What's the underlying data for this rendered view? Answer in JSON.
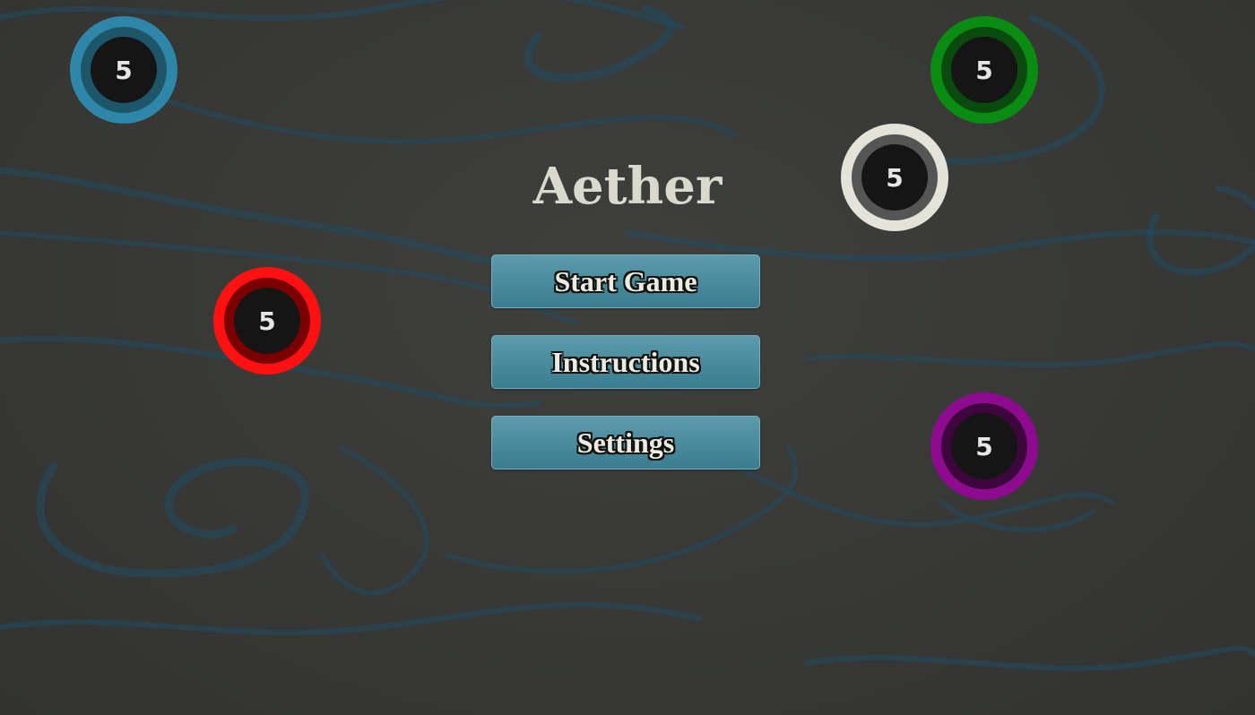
{
  "title": "Aether",
  "menu": {
    "start_label": "Start Game",
    "instructions_label": "Instructions",
    "settings_label": "Settings"
  },
  "tokens": [
    {
      "id": "blue",
      "value": "5",
      "ring": "#2e86a8",
      "inner": "#1d5569"
    },
    {
      "id": "green",
      "value": "5",
      "ring": "#0a8c12",
      "inner": "#0a4a0e"
    },
    {
      "id": "white",
      "value": "5",
      "ring": "#e4e3d9",
      "inner": "#555555"
    },
    {
      "id": "red",
      "value": "5",
      "ring": "#ff1111",
      "inner": "#7a0000"
    },
    {
      "id": "purple",
      "value": "5",
      "ring": "#8e0a8e",
      "inner": "#3d063d"
    }
  ],
  "colors": {
    "background": "#3a3b39",
    "button_fill": "#4b8c9d",
    "title_color": "#d9d9cd",
    "swirl_color": "#1f4d63"
  }
}
